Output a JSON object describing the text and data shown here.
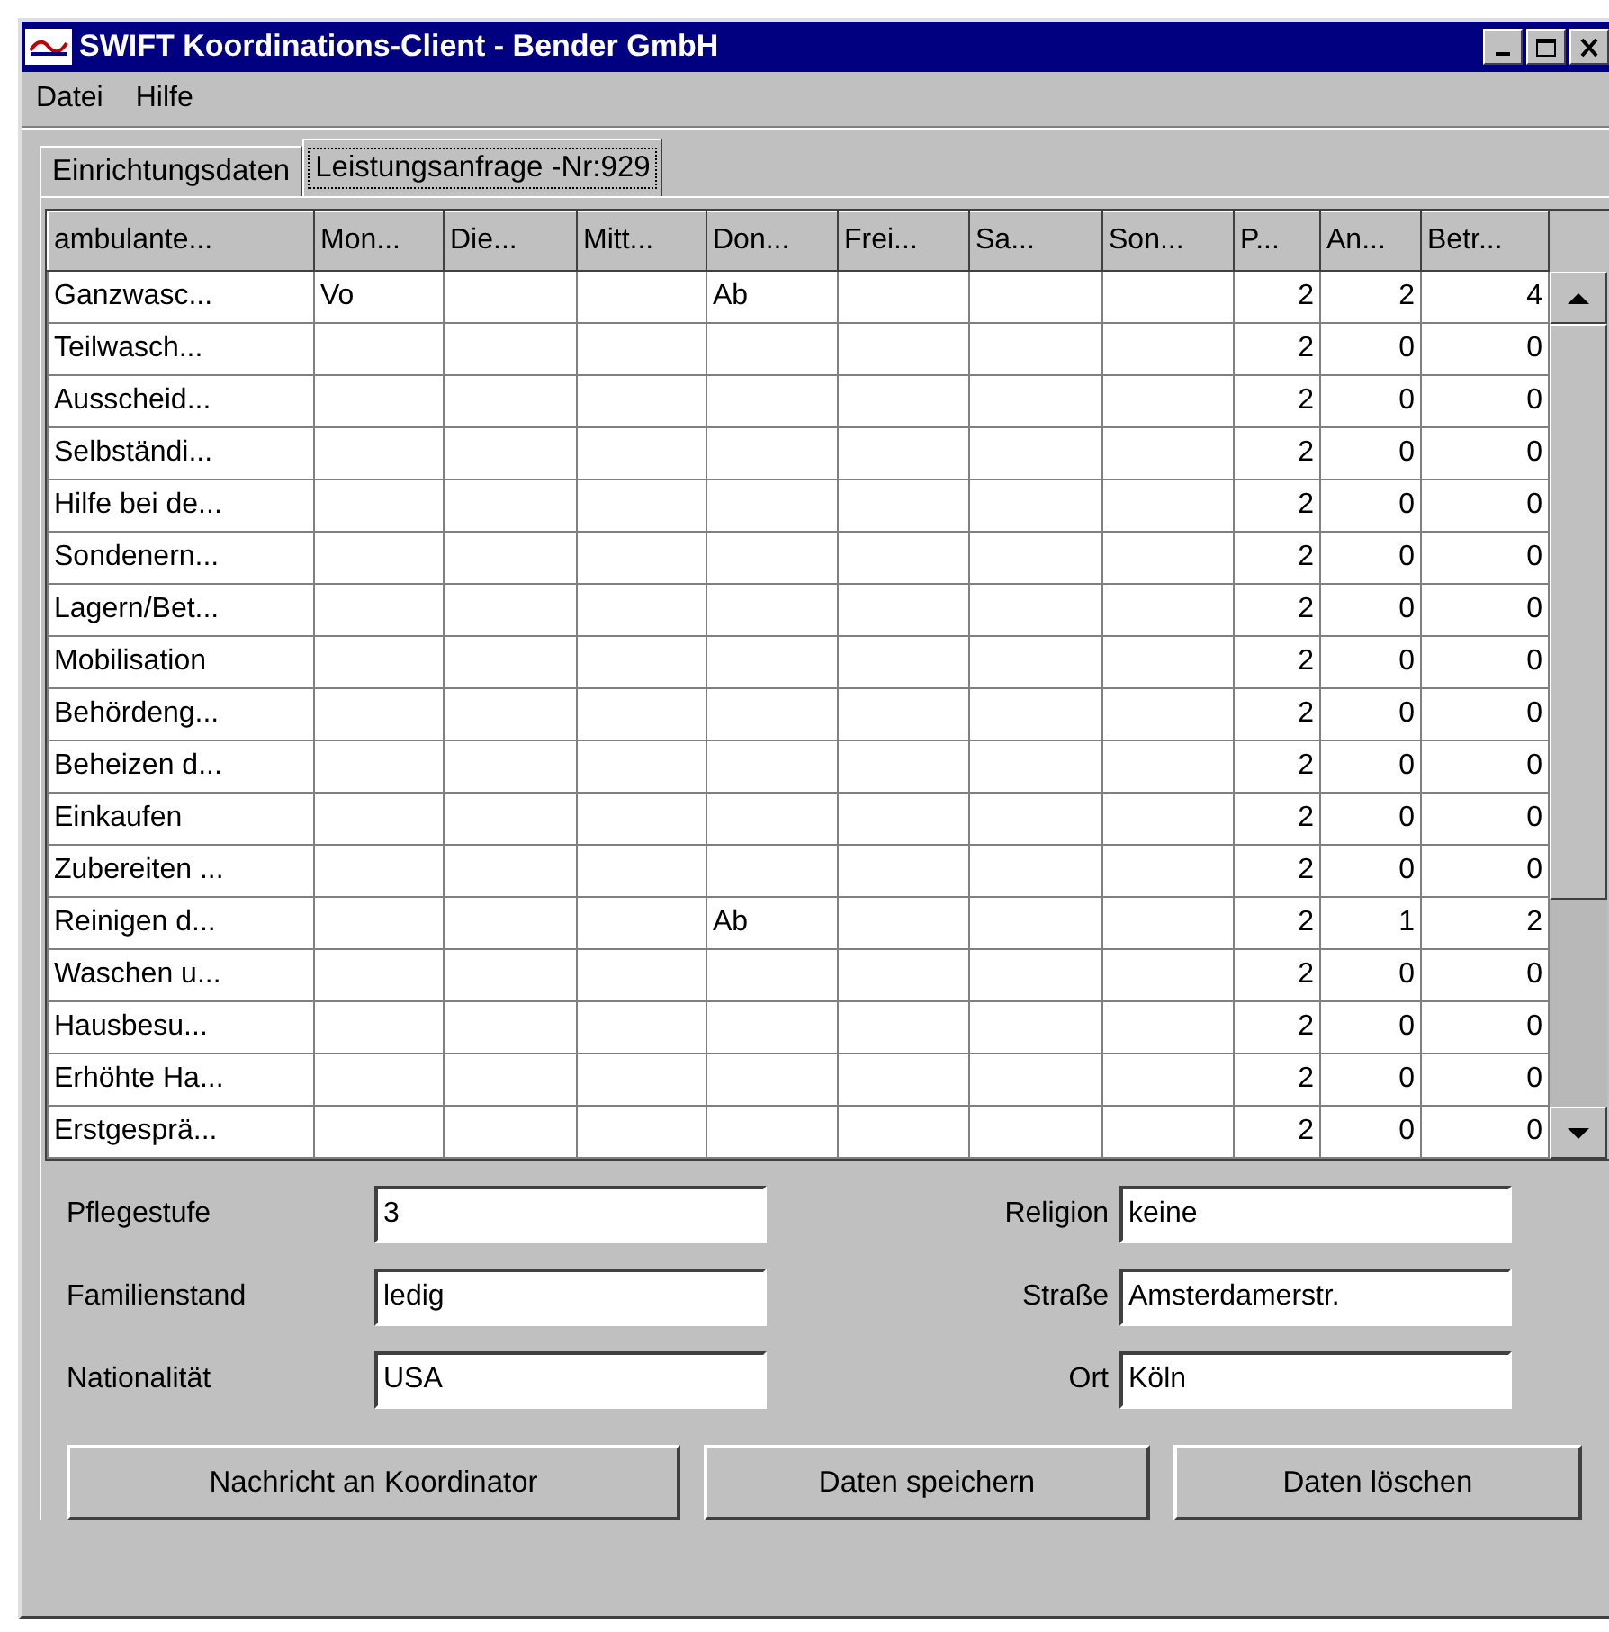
{
  "window": {
    "title": "SWIFT Koordinations-Client  -  Bender GmbH"
  },
  "menu": [
    "Datei",
    "Hilfe"
  ],
  "tabs": [
    {
      "label": "Einrichtungsdaten",
      "selected": false
    },
    {
      "label": "Leistungsanfrage -Nr:929",
      "selected": true
    }
  ],
  "table": {
    "columns": [
      "ambulante...",
      "Mon...",
      "Die...",
      "Mitt...",
      "Don...",
      "Frei...",
      "Sa...",
      "Son...",
      "P...",
      "An...",
      "Betr..."
    ],
    "rows": [
      [
        "Ganzwasc...",
        "Vo",
        "",
        "",
        "Ab",
        "",
        "",
        "",
        "2",
        "2",
        "4"
      ],
      [
        "Teilwasch...",
        "",
        "",
        "",
        "",
        "",
        "",
        "",
        "2",
        "0",
        "0"
      ],
      [
        "Ausscheid...",
        "",
        "",
        "",
        "",
        "",
        "",
        "",
        "2",
        "0",
        "0"
      ],
      [
        "Selbständi...",
        "",
        "",
        "",
        "",
        "",
        "",
        "",
        "2",
        "0",
        "0"
      ],
      [
        "Hilfe bei de...",
        "",
        "",
        "",
        "",
        "",
        "",
        "",
        "2",
        "0",
        "0"
      ],
      [
        "Sondenern...",
        "",
        "",
        "",
        "",
        "",
        "",
        "",
        "2",
        "0",
        "0"
      ],
      [
        "Lagern/Bet...",
        "",
        "",
        "",
        "",
        "",
        "",
        "",
        "2",
        "0",
        "0"
      ],
      [
        "Mobilisation",
        "",
        "",
        "",
        "",
        "",
        "",
        "",
        "2",
        "0",
        "0"
      ],
      [
        "Behördeng...",
        "",
        "",
        "",
        "",
        "",
        "",
        "",
        "2",
        "0",
        "0"
      ],
      [
        "Beheizen d...",
        "",
        "",
        "",
        "",
        "",
        "",
        "",
        "2",
        "0",
        "0"
      ],
      [
        "Einkaufen",
        "",
        "",
        "",
        "",
        "",
        "",
        "",
        "2",
        "0",
        "0"
      ],
      [
        "Zubereiten ...",
        "",
        "",
        "",
        "",
        "",
        "",
        "",
        "2",
        "0",
        "0"
      ],
      [
        "Reinigen d...",
        "",
        "",
        "",
        "Ab",
        "",
        "",
        "",
        "2",
        "1",
        "2"
      ],
      [
        "Waschen u...",
        "",
        "",
        "",
        "",
        "",
        "",
        "",
        "2",
        "0",
        "0"
      ],
      [
        "Hausbesu...",
        "",
        "",
        "",
        "",
        "",
        "",
        "",
        "2",
        "0",
        "0"
      ],
      [
        "Erhöhte Ha...",
        "",
        "",
        "",
        "",
        "",
        "",
        "",
        "2",
        "0",
        "0"
      ],
      [
        "Erstgesprä...",
        "",
        "",
        "",
        "",
        "",
        "",
        "",
        "2",
        "0",
        "0"
      ]
    ]
  },
  "form": {
    "left": [
      {
        "label": "Pflegestufe",
        "value": "3"
      },
      {
        "label": "Familienstand",
        "value": "ledig"
      },
      {
        "label": "Nationalität",
        "value": "USA"
      }
    ],
    "right": [
      {
        "label": "Religion",
        "value": "keine"
      },
      {
        "label": "Straße",
        "value": "Amsterdamerstr."
      },
      {
        "label": "Ort",
        "value": "Köln"
      }
    ]
  },
  "buttons": [
    "Nachricht an Koordinator",
    "Daten speichern",
    "Daten löschen"
  ]
}
